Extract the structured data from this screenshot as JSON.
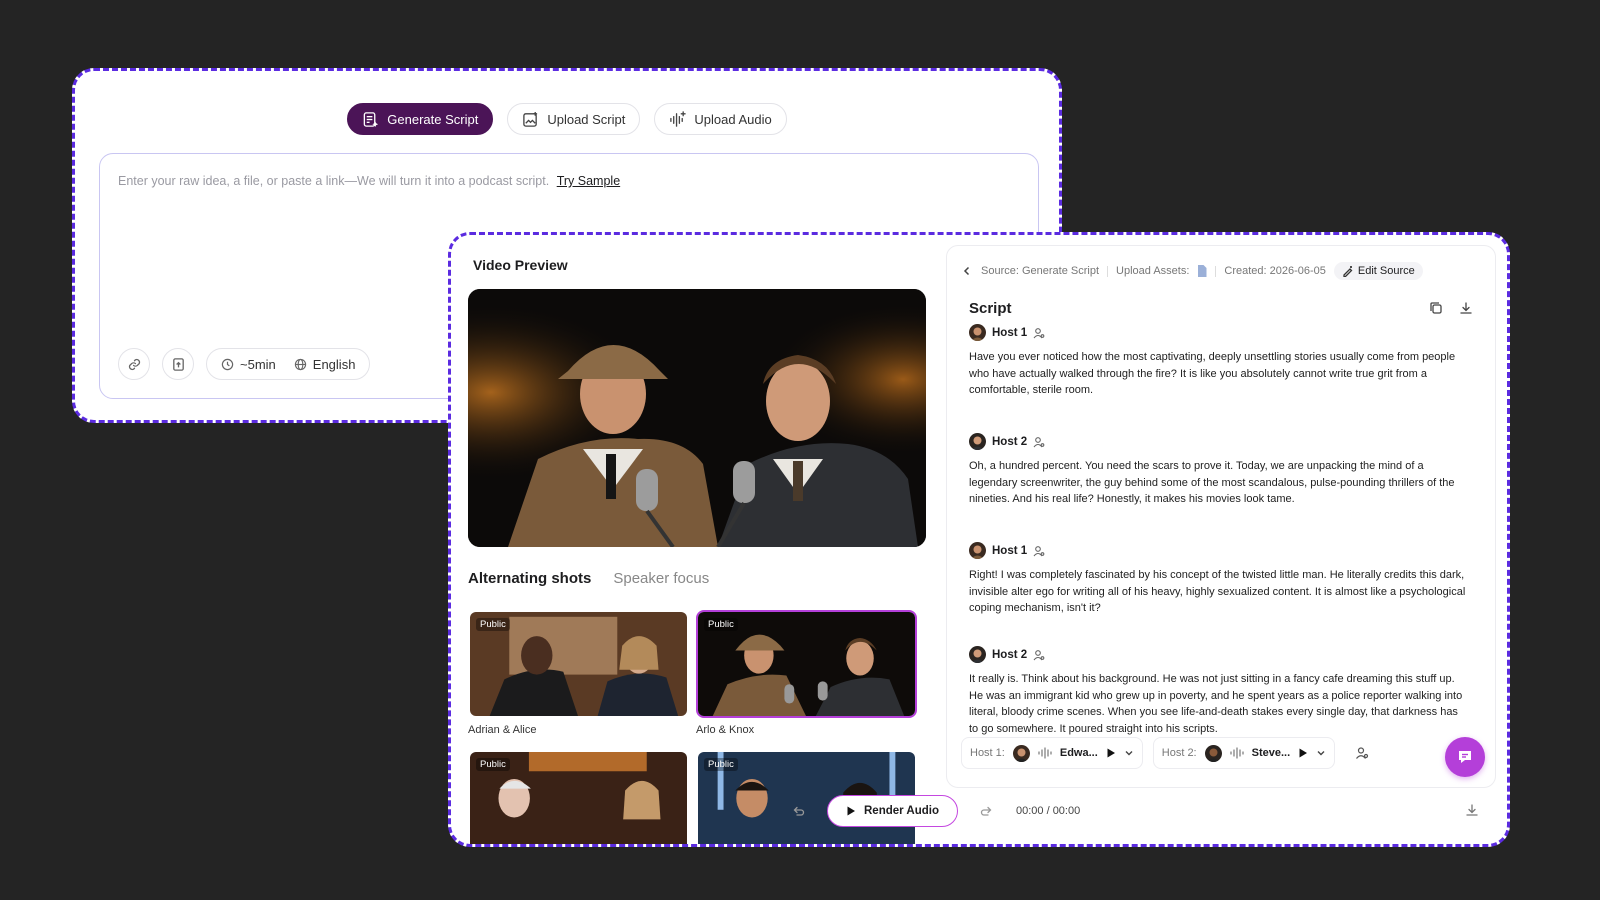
{
  "generator": {
    "tabs": [
      {
        "label": "Generate Script",
        "icon": "script-sparkle-icon",
        "active": true
      },
      {
        "label": "Upload Script",
        "icon": "image-upload-icon",
        "active": false
      },
      {
        "label": "Upload Audio",
        "icon": "waveform-icon",
        "active": false
      }
    ],
    "input_placeholder": "Enter your raw idea, a file, or paste a link—We will turn it into a podcast script.",
    "try_sample": "Try Sample",
    "duration": "~5min",
    "language": "English"
  },
  "preview": {
    "title": "Video Preview",
    "shot_tabs": [
      {
        "label": "Alternating shots",
        "active": true
      },
      {
        "label": "Speaker focus",
        "active": false
      }
    ],
    "thumbnails": [
      {
        "badge": "Public",
        "caption": "Adrian & Alice",
        "selected": false
      },
      {
        "badge": "Public",
        "caption": "Arlo & Knox",
        "selected": true
      },
      {
        "badge": "Public",
        "caption": "",
        "selected": false
      },
      {
        "badge": "Public",
        "caption": "",
        "selected": false
      }
    ]
  },
  "script": {
    "source": "Source: Generate Script",
    "upload_assets": "Upload Assets:",
    "created": "Created: 2026-06-05",
    "edit_source": "Edit Source",
    "title": "Script",
    "turns": [
      {
        "host": "Host 1",
        "text": "Have you ever noticed how the most captivating, deeply unsettling stories usually come from people who have actually walked through the fire? It is like you absolutely cannot write true grit from a comfortable, sterile room."
      },
      {
        "host": "Host 2",
        "text": "Oh, a hundred percent. You need the scars to prove it. Today, we are unpacking the mind of a legendary screenwriter, the guy behind some of the most scandalous, pulse-pounding thrillers of the nineties. And his real life? Honestly, it makes his movies look tame."
      },
      {
        "host": "Host 1",
        "text": "Right! I was completely fascinated by his concept of the twisted little man. He literally credits this dark, invisible alter ego for writing all of his heavy, highly sexualized content. It is almost like a psychological coping mechanism, isn't it?"
      },
      {
        "host": "Host 2",
        "text": "It really is. Think about his background. He was not just sitting in a fancy cafe dreaming this stuff up. He was an immigrant kid who grew up in poverty, and he spent years as a police reporter walking into literal, bloody crime scenes. When you see life-and-death stakes every single day, that darkness has to go somewhere. It poured straight into his scripts."
      }
    ],
    "voices": [
      {
        "label": "Host 1:",
        "voice": "Edwa..."
      },
      {
        "label": "Host 2:",
        "voice": "Steve..."
      }
    ]
  },
  "player": {
    "render_label": "Render Audio",
    "current_time": "00:00",
    "separator": "/",
    "total_time": "00:00"
  },
  "colors": {
    "accent_purple": "#4b1457",
    "highlight_magenta": "#b43fd9",
    "dashed_border": "#5b2be0",
    "page_background": "#242424"
  }
}
